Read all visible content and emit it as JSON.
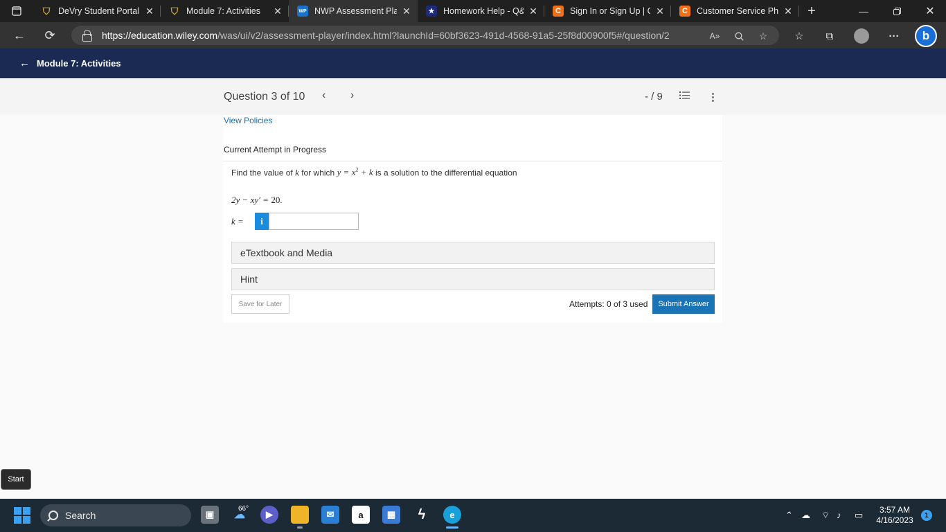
{
  "browser": {
    "tabs": [
      {
        "title": "DeVry Student Portal",
        "icon": "shield-icon",
        "active": false
      },
      {
        "title": "Module 7: Activities",
        "icon": "shield-icon",
        "active": false
      },
      {
        "title": "NWP Assessment Play",
        "icon": "wp-icon",
        "active": true
      },
      {
        "title": "Homework Help - Q&",
        "icon": "star-icon",
        "active": false
      },
      {
        "title": "Sign In or Sign Up | Ch",
        "icon": "chegg-icon",
        "active": false
      },
      {
        "title": "Customer Service Phor",
        "icon": "chegg-icon",
        "active": false
      }
    ],
    "url_host": "https://education.wiley.com",
    "url_path": "/was/ui/v2/assessment-player/index.html?launchId=60bf3623-491d-4568-91a5-25f8d00900f5#/question/2",
    "read_aloud_label": "A»",
    "wp_icon_text": "WP",
    "chegg_icon_text": "C",
    "bing_icon_text": "b"
  },
  "header": {
    "back_label": "Module 7: Activities"
  },
  "question_bar": {
    "counter": "Question 3 of 10",
    "score": "- / 9"
  },
  "card": {
    "view_policies": "View Policies",
    "attempt_status": "Current Attempt in Progress",
    "prompt_before": "Find the value of",
    "prompt_var": "k",
    "prompt_mid": "for which",
    "prompt_after": "is a solution to the differential equation",
    "equation_rhs": "20.",
    "answer_label": "k =",
    "info_label": "i",
    "answer_value": "",
    "etextbook_label": "eTextbook and Media",
    "hint_label": "Hint",
    "save_label": "Save for Later",
    "attempts_text": "Attempts: 0 of 3 used",
    "submit_label": "Submit Answer"
  },
  "start_tooltip": "Start",
  "taskbar": {
    "search_label": "Search",
    "weather_temp": "66°",
    "amazon_icon_text": "a",
    "time": "3:57 AM",
    "date": "4/16/2023",
    "notification_count": "1"
  },
  "colors": {
    "header_bg": "#1b2a52",
    "submit_bg": "#1a73b5",
    "link": "#1a6ca8",
    "taskbar_bg": "#1c2a36"
  }
}
